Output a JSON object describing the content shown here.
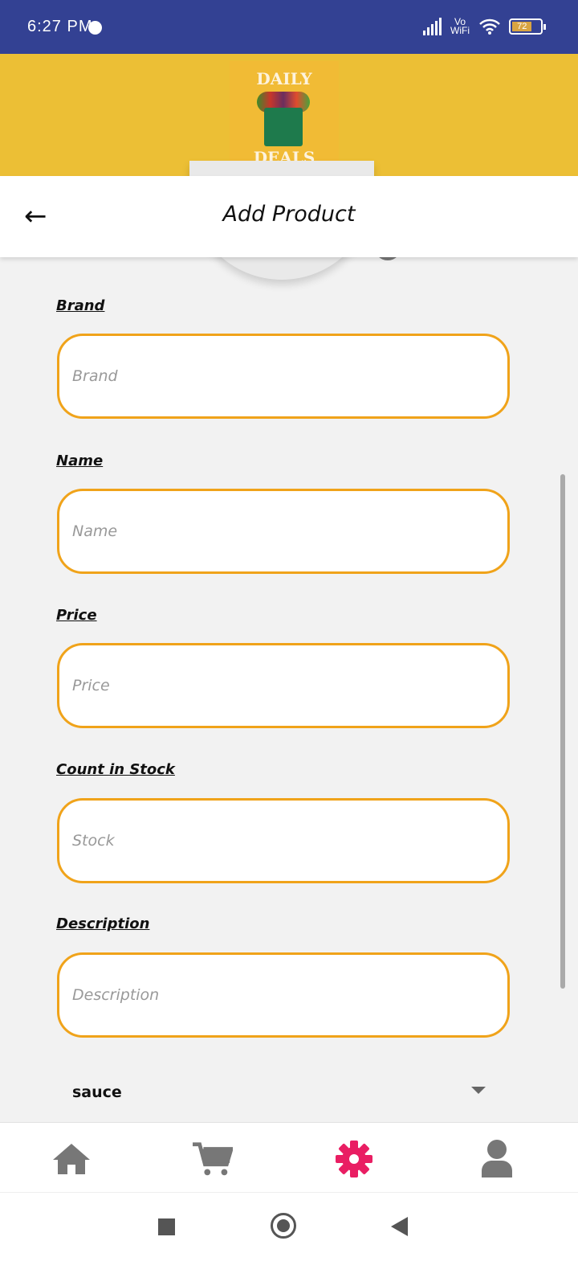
{
  "status_bar": {
    "time": "6:27 PM",
    "network": "Vo WiFi",
    "battery": "72"
  },
  "logo": {
    "line1": "DAILY",
    "line2": "DEALS"
  },
  "toolbar": {
    "title": "Add Product",
    "back_icon": "arrow-left-icon"
  },
  "form": {
    "fields": [
      {
        "label": "Brand",
        "placeholder": "Brand",
        "value": ""
      },
      {
        "label": "Name",
        "placeholder": "Name",
        "value": ""
      },
      {
        "label": "Price",
        "placeholder": "Price",
        "value": ""
      },
      {
        "label": "Count in Stock",
        "placeholder": "Stock",
        "value": ""
      },
      {
        "label": "Description",
        "placeholder": "Description",
        "value": ""
      }
    ],
    "category": {
      "selected": "sauce"
    }
  },
  "bottom_nav": {
    "items": [
      {
        "icon": "home-icon"
      },
      {
        "icon": "cart-icon"
      },
      {
        "icon": "gear-icon",
        "active": true
      },
      {
        "icon": "user-icon"
      }
    ]
  },
  "colors": {
    "status_bar": "#334193",
    "header": "#ecbf35",
    "input_border": "#f0a31a",
    "active_nav": "#e91e63",
    "inactive_nav": "#777777"
  }
}
